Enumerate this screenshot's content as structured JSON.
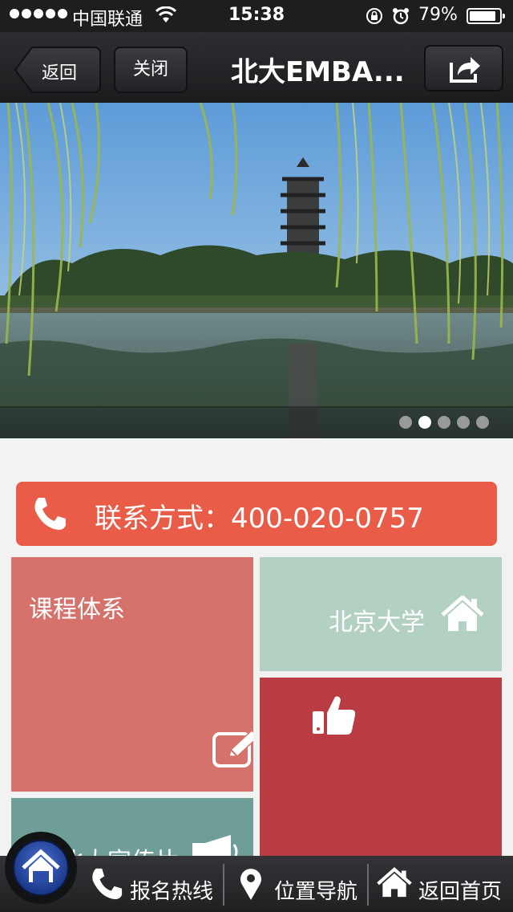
{
  "status_bar": {
    "carrier": "中国联通",
    "time": "15:38",
    "battery": "79%"
  },
  "nav": {
    "back_label": "返回",
    "close_label": "关闭",
    "title": "北大EMBA..."
  },
  "banner": {
    "slide_count": 5,
    "active_slide": 2
  },
  "contact": {
    "label": "联系方式：400-020-0757"
  },
  "tiles": {
    "courses": "课程体系",
    "pku": "北京大学",
    "video": "北大宣传片"
  },
  "bottom_bar": {
    "hotline": "报名热线",
    "location": "位置导航",
    "home": "返回首页"
  },
  "icons": {
    "share": "share-icon",
    "phone": "phone-icon",
    "edit": "edit-icon",
    "home": "home-icon",
    "thumbs_up": "thumbs-up-icon",
    "megaphone": "megaphone-icon",
    "location": "location-pin-icon"
  },
  "colors": {
    "contact": "#e95c48",
    "courses": "#d6726c",
    "pku": "#b3d1c2",
    "like": "#b93c42",
    "video": "#6e9e97"
  }
}
